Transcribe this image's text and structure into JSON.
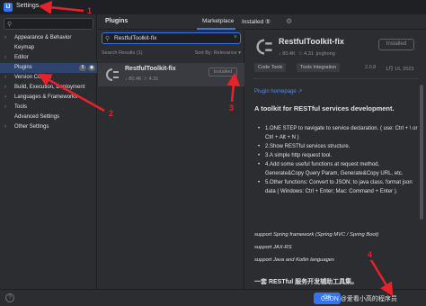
{
  "window": {
    "app_icon": "IJ",
    "title": "Settings"
  },
  "sidebar": {
    "search_icon": "search-icon",
    "items": [
      {
        "label": "Appearance & Behavior",
        "arrow": "›",
        "badges": []
      },
      {
        "label": "Keymap",
        "arrow": "",
        "badges": []
      },
      {
        "label": "Editor",
        "arrow": "›",
        "badges": []
      },
      {
        "label": "Plugins",
        "arrow": "",
        "badges": [
          "5",
          "◉"
        ]
      },
      {
        "label": "Version Control",
        "arrow": "›",
        "badges": []
      },
      {
        "label": "Build, Execution, Deployment",
        "arrow": "›",
        "badges": []
      },
      {
        "label": "Languages & Frameworks",
        "arrow": "›",
        "badges": []
      },
      {
        "label": "Tools",
        "arrow": "›",
        "badges": []
      },
      {
        "label": "Advanced Settings",
        "arrow": "",
        "badges": []
      },
      {
        "label": "Other Settings",
        "arrow": "›",
        "badges": []
      }
    ]
  },
  "plugins": {
    "title": "Plugins",
    "tabs": {
      "marketplace": "Marketplace",
      "installed": "Installed",
      "installed_count": "⑤"
    },
    "search_value": "RestfulToolkit-fix",
    "clear_label": "×",
    "results_label": "Search Results (1)",
    "sort_label": "Sort By: Relevance ▾",
    "item": {
      "name": "RestfulToolkit-fix",
      "downloads": "↓ 80.4K",
      "rating": "☆ 4.31",
      "button": "Installed"
    }
  },
  "detail": {
    "name": "RestfulToolkit-fix",
    "downloads": "↓ 80.4K",
    "rating": "☆ 4.31",
    "author": "jinghong",
    "button": "Installed",
    "tags": [
      "Code Tools",
      "Tools Integration"
    ],
    "version": "2.0.8",
    "date": "1月 16, 2023",
    "homepage": "Plugin homepage ↗",
    "heading": "A toolkit for RESTful services development.",
    "list": [
      "1.ONE STEP to navigate to service declaration. ( use: Ctrl + \\ or Ctrl + Alt + N )",
      "2.Show RESTful services structure.",
      "3.A simple http request tool.",
      "4.Add some useful functions at request method, Generate&Copy Query Param, Generate&Copy URL, etc.",
      "5.Other functions: Convert to JSON; to java class. format json data ( Windows: Ctrl + Enter; Mac: Command + Enter )."
    ],
    "support1": "support Spring framework (Spring MVC / Spring Boot)",
    "support2": "support JAX-RS",
    "support3": "support Java and Kotlin languages",
    "cn_heading": "一套 RESTful 服务开发辅助工具集。"
  },
  "footer": {
    "help": "?",
    "ok": "OK",
    "watermark": "CSDN @爱看小高的程序员"
  },
  "annotations": [
    "1",
    "2",
    "3",
    "4"
  ],
  "colors": {
    "accent": "#3574f0",
    "selection": "#2e436e",
    "annotation": "#e8222a",
    "link": "#548af7"
  }
}
